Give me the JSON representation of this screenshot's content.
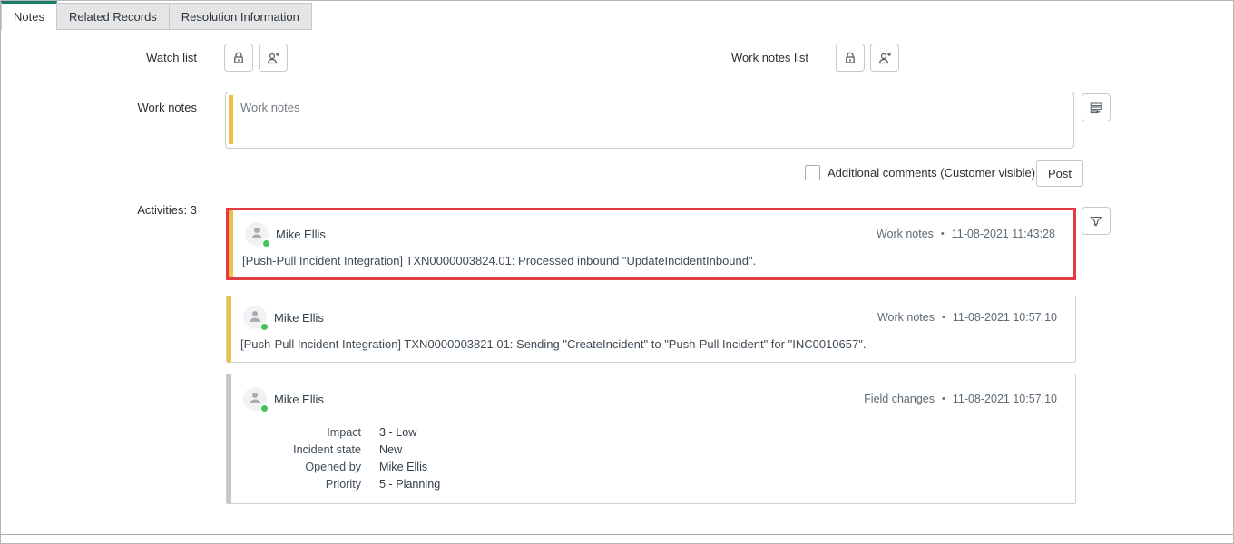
{
  "tabs": [
    {
      "label": "Notes",
      "active": true
    },
    {
      "label": "Related Records",
      "active": false
    },
    {
      "label": "Resolution Information",
      "active": false
    }
  ],
  "form": {
    "watch_list": {
      "label": "Watch list"
    },
    "work_notes_list": {
      "label": "Work notes list"
    },
    "work_notes": {
      "label": "Work notes",
      "placeholder": "Work notes",
      "value": ""
    },
    "additional_comments": {
      "label": "Additional comments (Customer visible)",
      "checked": false
    },
    "post_button": {
      "label": "Post"
    }
  },
  "activities": {
    "header": "Activities: 3",
    "count": 3,
    "items": [
      {
        "author": "Mike Ellis",
        "category": "Work notes",
        "separator": "•",
        "timestamp": "11-08-2021 11:43:28",
        "body": "[Push-Pull Incident Integration] TXN0000003824.01: Processed inbound \"UpdateIncidentInbound\".",
        "highlighted": true,
        "accent": "#f0c044"
      },
      {
        "author": "Mike Ellis",
        "category": "Work notes",
        "separator": "•",
        "timestamp": "11-08-2021 10:57:10",
        "body": "[Push-Pull Incident Integration] TXN0000003821.01: Sending \"CreateIncident\" to \"Push-Pull Incident\" for \"INC0010657\".",
        "highlighted": false,
        "accent": "#f0c044"
      },
      {
        "author": "Mike Ellis",
        "category": "Field changes",
        "separator": "•",
        "timestamp": "11-08-2021 10:57:10",
        "highlighted": false,
        "accent": "#c5c8cb",
        "fields": [
          {
            "label": "Impact",
            "value": "3 - Low"
          },
          {
            "label": "Incident state",
            "value": "New"
          },
          {
            "label": "Opened by",
            "value": "Mike Ellis"
          },
          {
            "label": "Priority",
            "value": "5 - Planning"
          }
        ]
      }
    ]
  },
  "icons": {
    "lock": "lock-icon",
    "add_user": "add-user-icon",
    "activity_stream": "activity-stream-icon",
    "filter": "filter-icon",
    "avatar": "user-avatar-icon"
  },
  "colors": {
    "active_tab_accent": "#1b7a68",
    "work_notes_accent": "#f0c044",
    "field_changes_accent": "#c5c8cb",
    "highlight_border": "#e03c42",
    "presence_online": "#47c15b"
  }
}
